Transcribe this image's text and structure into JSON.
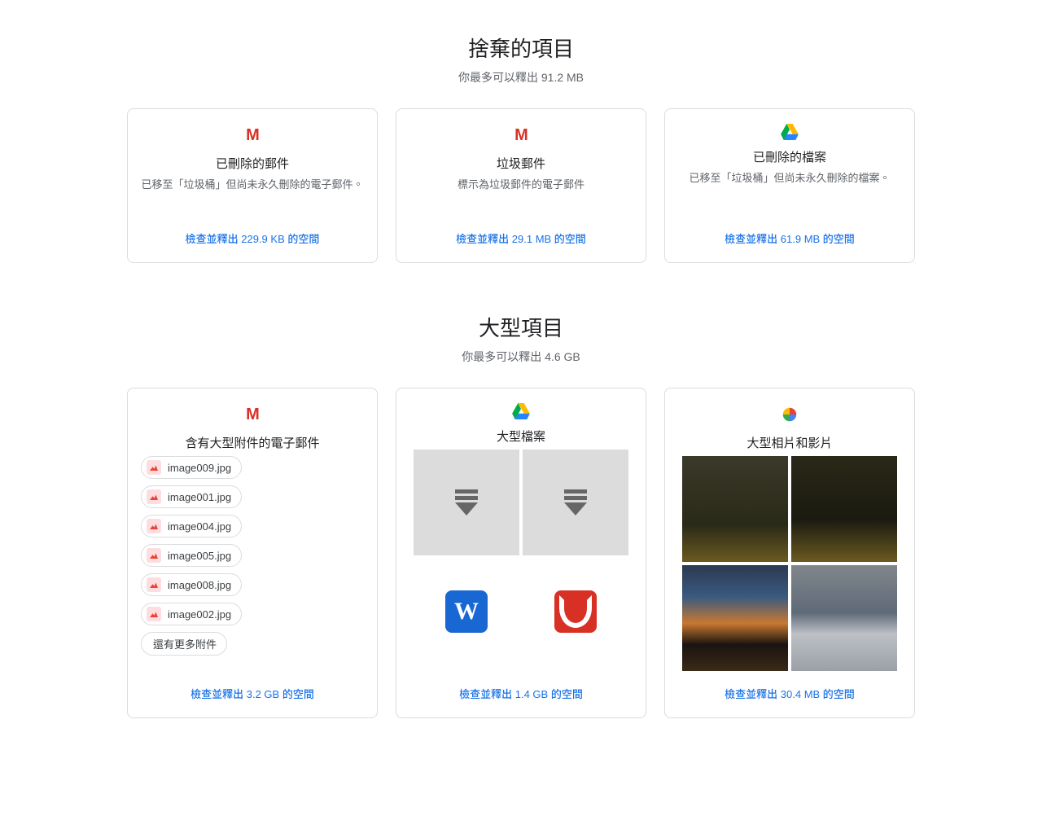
{
  "sections": [
    {
      "title": "捨棄的項目",
      "subtitle": "你最多可以釋出 91.2 MB",
      "cards": [
        {
          "icon": "gmail",
          "title": "已刪除的郵件",
          "desc": "已移至「垃圾桶」但尚未永久刪除的電子郵件。",
          "link": "檢查並釋出 229.9 KB 的空間"
        },
        {
          "icon": "gmail",
          "title": "垃圾郵件",
          "desc": "標示為垃圾郵件的電子郵件",
          "link": "檢查並釋出 29.1 MB 的空間"
        },
        {
          "icon": "drive",
          "title": "已刪除的檔案",
          "desc": "已移至「垃圾桶」但尚未永久刪除的檔案。",
          "link": "檢查並釋出 61.9 MB 的空間"
        }
      ]
    },
    {
      "title": "大型項目",
      "subtitle": "你最多可以釋出 4.6 GB",
      "cards": [
        {
          "icon": "gmail",
          "title": "含有大型附件的電子郵件",
          "attachments": [
            "image009.jpg",
            "image001.jpg",
            "image004.jpg",
            "image005.jpg",
            "image008.jpg",
            "image002.jpg"
          ],
          "more": "還有更多附件",
          "link": "檢查並釋出 3.2 GB 的空間"
        },
        {
          "icon": "drive",
          "title": "大型檔案",
          "link": "檢查並釋出 1.4 GB 的空間"
        },
        {
          "icon": "photos",
          "title": "大型相片和影片",
          "link": "檢查並釋出 30.4 MB 的空間"
        }
      ]
    }
  ]
}
